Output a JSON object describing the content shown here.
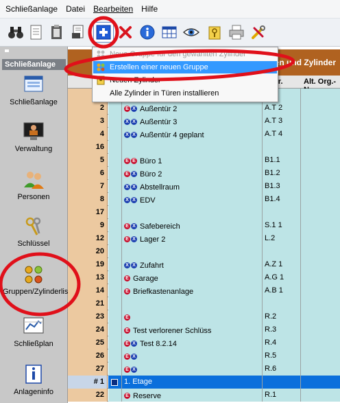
{
  "menubar": {
    "items": [
      "Schließanlage",
      "Datei",
      "Bearbeiten",
      "Hilfe"
    ]
  },
  "toolbar": {
    "buttons": [
      {
        "icon": "binoculars-icon"
      },
      {
        "icon": "document-icon"
      },
      {
        "icon": "clipboard-icon"
      },
      {
        "icon": "print-preview-icon"
      },
      {
        "icon": "add-icon"
      },
      {
        "icon": "delete-icon"
      },
      {
        "icon": "info-icon"
      },
      {
        "icon": "table-icon"
      },
      {
        "icon": "eye-icon"
      },
      {
        "icon": "key-folder-icon"
      },
      {
        "icon": "printer-icon"
      },
      {
        "icon": "tools-icon"
      }
    ]
  },
  "sidebar": {
    "header": "Schließanlage",
    "items": [
      {
        "label": "Schließanlage",
        "icon": "window-icon"
      },
      {
        "label": "Verwaltung",
        "icon": "monitor-user-icon"
      },
      {
        "label": "Personen",
        "icon": "people-icon"
      },
      {
        "label": "Schlüssel",
        "icon": "keys-icon"
      },
      {
        "label": "Gruppen/Zylinderliste",
        "icon": "cylinder-group-icon"
      },
      {
        "label": "Schließplan",
        "icon": "plan-icon"
      },
      {
        "label": "Anlageninfo",
        "icon": "info-book-icon"
      }
    ]
  },
  "main": {
    "tab_title": "en und Zylinder",
    "columns": {
      "nr": "...-Nr.",
      "alt": "Alt. Org.-N"
    },
    "rows": [
      {
        "num": "",
        "badges": [],
        "name": "",
        "nr": "..1"
      },
      {
        "num": "2",
        "badges": [
          "E",
          "X"
        ],
        "name": "Außentür 2",
        "nr": "A.T 2"
      },
      {
        "num": "3",
        "badges": [
          "X",
          "X"
        ],
        "name": "Außentür 3",
        "nr": "A.T 3"
      },
      {
        "num": "4",
        "badges": [
          "X",
          "X"
        ],
        "name": "Außentür 4 geplant",
        "nr": "A.T 4"
      },
      {
        "num": "16",
        "badges": [],
        "name": "",
        "nr": ""
      },
      {
        "num": "5",
        "badges": [
          "E",
          "E"
        ],
        "name": "Büro 1",
        "nr": "B1.1"
      },
      {
        "num": "6",
        "badges": [
          "E",
          "X"
        ],
        "name": "Büro 2",
        "nr": "B1.2"
      },
      {
        "num": "7",
        "badges": [
          "X",
          "X"
        ],
        "name": "Abstellraum",
        "nr": "B1.3"
      },
      {
        "num": "8",
        "badges": [
          "X",
          "X"
        ],
        "name": "EDV",
        "nr": "B1.4"
      },
      {
        "num": "17",
        "badges": [],
        "name": "",
        "nr": ""
      },
      {
        "num": "9",
        "badges": [
          "E",
          "X"
        ],
        "name": "Safebereich",
        "nr": "S.1 1"
      },
      {
        "num": "12",
        "badges": [
          "E",
          "X"
        ],
        "name": "Lager 2",
        "nr": "L.2"
      },
      {
        "num": "20",
        "badges": [],
        "name": "",
        "nr": ""
      },
      {
        "num": "19",
        "badges": [
          "X",
          "X"
        ],
        "name": "Zufahrt",
        "nr": "A.Z 1"
      },
      {
        "num": "13",
        "badges": [
          "E"
        ],
        "name": "Garage",
        "nr": "A.G 1"
      },
      {
        "num": "14",
        "badges": [
          "E"
        ],
        "name": "Briefkastenanlage",
        "nr": "A.B 1"
      },
      {
        "num": "21",
        "badges": [],
        "name": "",
        "nr": ""
      },
      {
        "num": "23",
        "badges": [
          "E"
        ],
        "name": "",
        "nr": "R.2"
      },
      {
        "num": "24",
        "badges": [
          "E"
        ],
        "name": "Test verlorener Schlüss",
        "nr": "R.3"
      },
      {
        "num": "25",
        "badges": [
          "E",
          "X"
        ],
        "name": "Test 8.2.14",
        "nr": "R.4"
      },
      {
        "num": "26",
        "badges": [
          "E",
          "X"
        ],
        "name": "",
        "nr": "R.5"
      },
      {
        "num": "27",
        "badges": [
          "E",
          "X"
        ],
        "name": "",
        "nr": "R.6"
      },
      {
        "num": "# 1",
        "badges": [],
        "name": "1. Etage",
        "nr": "",
        "selected": true
      },
      {
        "num": "22",
        "badges": [
          "E"
        ],
        "name": "Reserve",
        "nr": "R.1"
      }
    ]
  },
  "dropdown": {
    "items": [
      {
        "label": "Neue Gruppe für den gewählten Zylinder",
        "state": "disabled",
        "icon": "group-small-icon"
      },
      {
        "label": "Erstellen einer neuen Gruppe",
        "state": "highlighted",
        "icon": "group-new-icon"
      },
      {
        "label": "Neuen Zylinder",
        "state": "normal",
        "icon": "cylinder-new-icon"
      },
      {
        "label": "Alle Zylinder in Türen installieren",
        "state": "normal",
        "icon": ""
      }
    ]
  },
  "colors": {
    "row_number_bg": "#ecc9a0",
    "cell_bg": "#bde4e6",
    "selection": "#0a6fdc",
    "highlight": "#3399ff",
    "annotation": "#e0101a",
    "header_brown": "#b06220"
  }
}
